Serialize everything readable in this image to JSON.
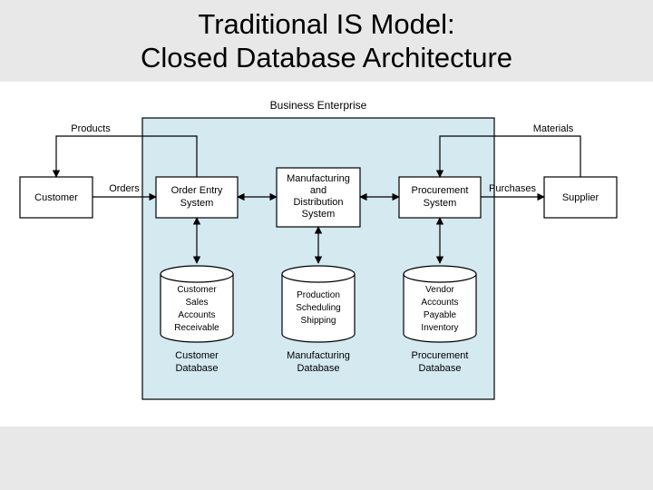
{
  "title_line1": "Traditional IS Model:",
  "title_line2": "Closed Database Architecture",
  "diagram_title": "Business Enterprise",
  "boxes": {
    "customer": "Customer",
    "order_entry_l1": "Order Entry",
    "order_entry_l2": "System",
    "mfg_l1": "Manufacturing",
    "mfg_l2": "and",
    "mfg_l3": "Distribution",
    "mfg_l4": "System",
    "proc_l1": "Procurement",
    "proc_l2": "System",
    "supplier": "Supplier"
  },
  "edges": {
    "products": "Products",
    "orders": "Orders",
    "materials": "Materials",
    "purchases": "Purchases"
  },
  "cylinders": {
    "cust_l1": "Customer",
    "cust_l2": "Sales",
    "cust_l3": "Accounts",
    "cust_l4": "Receivable",
    "mfg_l1": "Production",
    "mfg_l2": "Scheduling",
    "mfg_l3": "Shipping",
    "proc_l1": "Vendor",
    "proc_l2": "Accounts",
    "proc_l3": "Payable",
    "proc_l4": "Inventory"
  },
  "db_labels": {
    "cust_l1": "Customer",
    "cust_l2": "Database",
    "mfg_l1": "Manufacturing",
    "mfg_l2": "Database",
    "proc_l1": "Procurement",
    "proc_l2": "Database"
  }
}
